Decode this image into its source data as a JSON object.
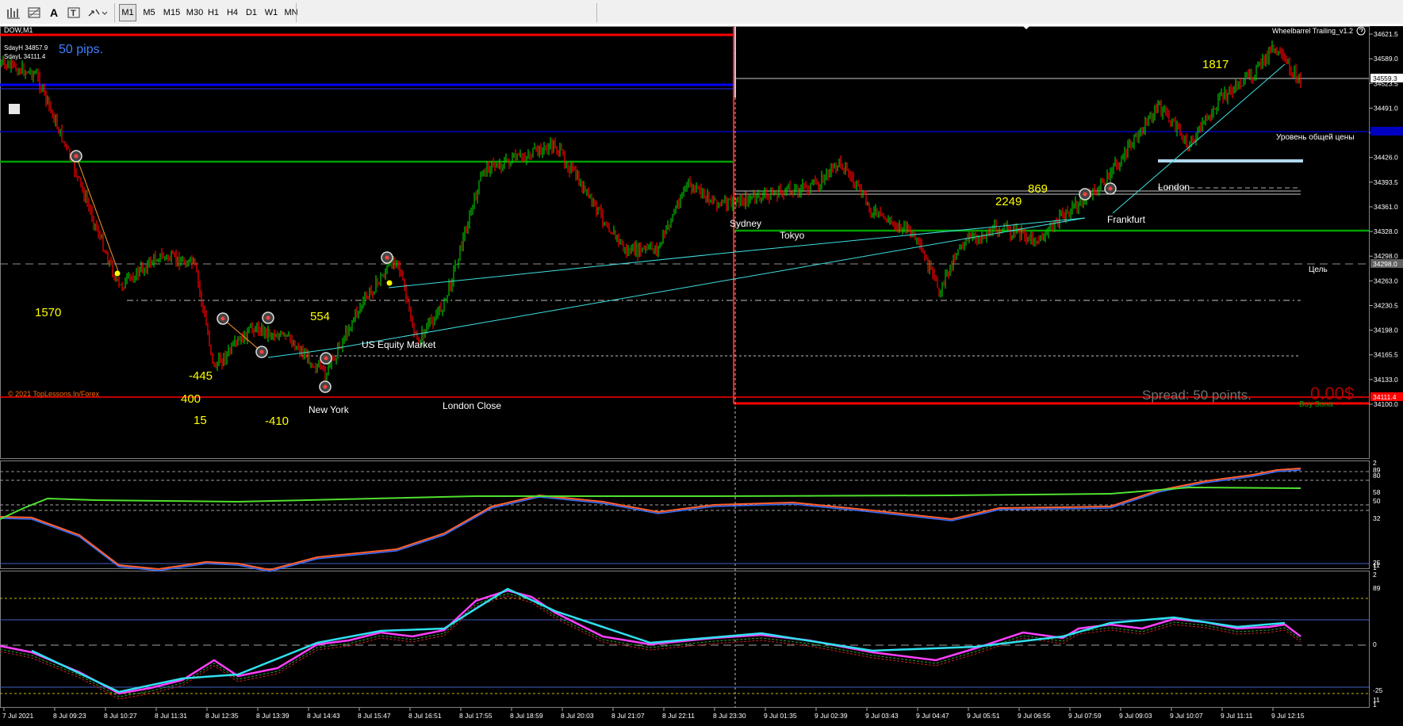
{
  "toolbar": {
    "tools": [
      {
        "name": "bar-chart-icon"
      },
      {
        "name": "fibonacci-icon"
      },
      {
        "name": "text-tool-icon"
      },
      {
        "name": "text-label-icon"
      },
      {
        "name": "arrows-icon"
      }
    ],
    "timeframes": [
      "M1",
      "M5",
      "M15",
      "M30",
      "H1",
      "H4",
      "D1",
      "W1",
      "MN"
    ],
    "selected_timeframe": "M1"
  },
  "chart": {
    "symbol": "DOW,M1",
    "indicator_name": "Wheelbarrel Trailing_v1.2",
    "pips_text": "50 pips.",
    "sday_high": "SdayH 34857.9",
    "sday_low": "SdayL 34111.4",
    "copyright": "© 2021 TopLessons.In/Forex",
    "spread_text": "Spread: 50 points.",
    "profit_text": "0.00$",
    "buy_zone": "Buy Зона",
    "level_label_price": "Уровень общей цены",
    "level_label_target": "Цель",
    "sessions": [
      "Sydney",
      "Tokyo",
      "London",
      "Frankfurt",
      "New York",
      "London Close",
      "US Equity Market"
    ],
    "wave_numbers": [
      "1570",
      "554",
      "-445",
      "400",
      "15",
      "-410",
      "2249",
      "869",
      "1817"
    ],
    "price_axis": [
      "34621.5",
      "34589.0",
      "34523.5",
      "34491.0",
      "34458.5",
      "34426.0",
      "34393.5",
      "34361.0",
      "34328.0",
      "34298.0",
      "34263.0",
      "34230.5",
      "34198.0",
      "34165.5",
      "34133.0",
      "34100.0"
    ],
    "price_tags": {
      "current": "34559.3",
      "target": "34298.0",
      "low": "34111.4"
    },
    "time_axis": [
      "7 Jul 2021",
      "8 Jul 09:23",
      "8 Jul 10:27",
      "8 Jul 11:31",
      "8 Jul 12:35",
      "8 Jul 13:39",
      "8 Jul 14:43",
      "8 Jul 15:47",
      "8 Jul 16:51",
      "8 Jul 17:55",
      "8 Jul 18:59",
      "8 Jul 20:03",
      "8 Jul 21:07",
      "8 Jul 22:11",
      "8 Jul 23:30",
      "9 Jul 01:35",
      "9 Jul 02:39",
      "9 Jul 03:43",
      "9 Jul 04:47",
      "9 Jul 05:51",
      "9 Jul 06:55",
      "9 Jul 07:59",
      "9 Jul 09:03",
      "9 Jul 10:07",
      "9 Jul 11:11",
      "9 Jul 12:15"
    ],
    "sub1_axis": [
      "2",
      "89",
      "80",
      "58",
      "50",
      "32",
      "25",
      "11",
      "1"
    ],
    "sub2_axis": [
      "2",
      "89",
      "0",
      "-25",
      "11",
      "1"
    ]
  },
  "colors": {
    "candle_up": "#00c000",
    "candle_down": "#ff0000",
    "trend_line": "#40e0e0",
    "wave_text": "#ffff00",
    "level_blue": "#0000ff",
    "level_green": "#00a000",
    "level_red": "#ff0000"
  }
}
